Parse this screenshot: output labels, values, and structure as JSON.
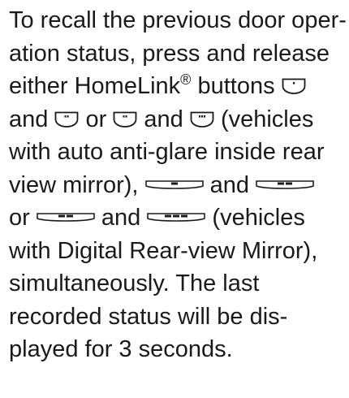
{
  "paragraph": {
    "l1": "To recall the previous door oper-",
    "l2": "ation status, press and release",
    "l3_pre": "either HomeLink",
    "l3_reg": "®",
    "l3_post": " buttons ",
    "l4_and1": "and ",
    "l4_or": " or ",
    "l4_and2": " and ",
    "l4_post": " (vehicles",
    "l5": "with auto anti-glare inside rear",
    "l6_pre": "view mirror), ",
    "l6_and": " and ",
    "l7_or": "or ",
    "l7_and": " and ",
    "l7_post": " (vehicles",
    "l8": "with Digital Rear-view Mirror),",
    "l9": "simultaneously. The last",
    "l10": "recorded status will be dis-",
    "l11": "played for 3 seconds."
  },
  "icons": {
    "aag_button_1": "homelink-button-1-dot-icon",
    "aag_button_2": "homelink-button-2-dots-icon",
    "aag_button_3": "homelink-button-3-dots-icon",
    "drm_button_1": "mirror-button-1-bar-icon",
    "drm_button_2": "mirror-button-2-bars-icon",
    "drm_button_3": "mirror-button-3-bars-icon"
  }
}
